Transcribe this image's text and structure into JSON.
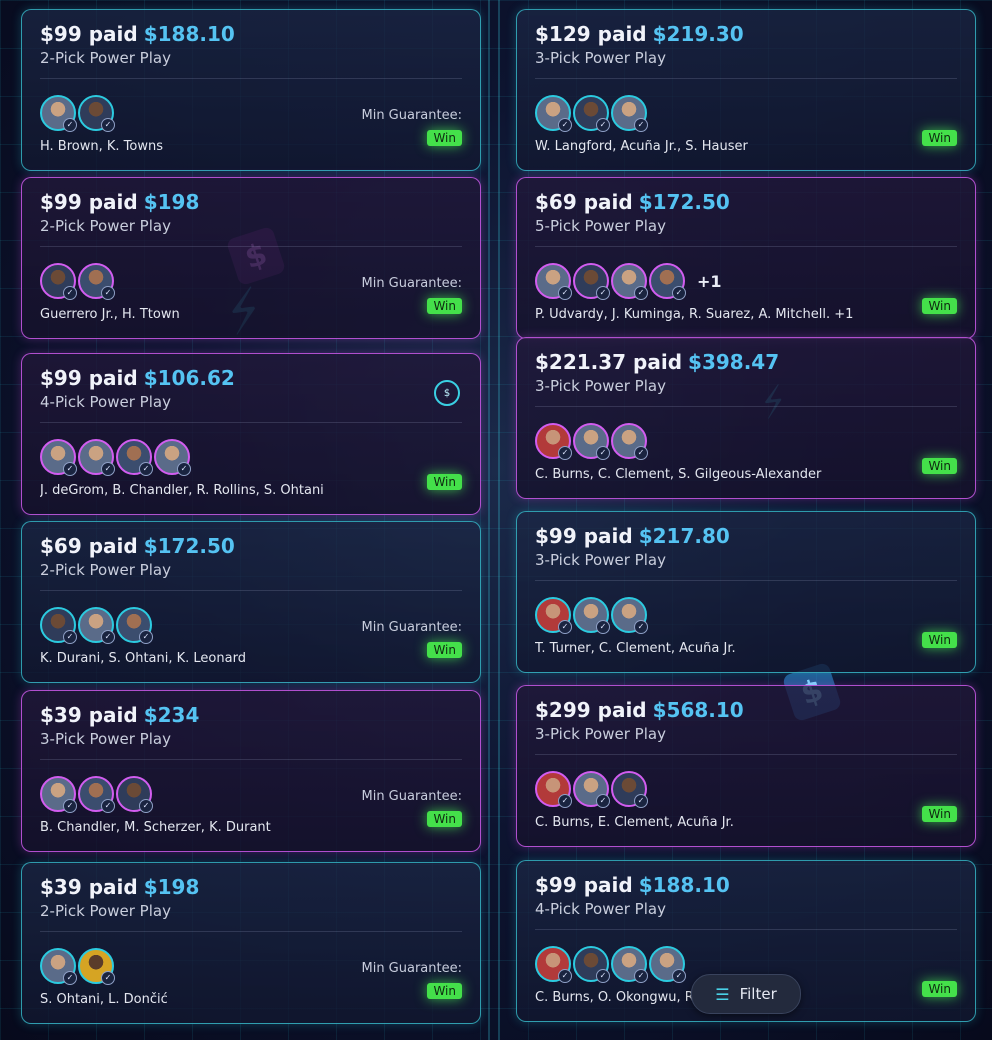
{
  "colors": {
    "accent_teal": "#3ac8d7",
    "accent_purple": "#cd5aeb",
    "payout_blue": "#55c3f2",
    "win_green": "#44e04a"
  },
  "filter_label": "Filter",
  "filter_icon": "sliders-icon",
  "cards": [
    {
      "paid": "$99 paid",
      "payout": "$188.10",
      "type": "2-Pick Power Play",
      "players": "H. Brown, K. Towns",
      "guarantee": "Min Guarantee:",
      "result": "Win",
      "avatars": 2,
      "more": "",
      "theme": "teal",
      "icon": ""
    },
    {
      "paid": "$99 paid",
      "payout": "$198",
      "type": "2-Pick Power Play",
      "players": "Guerrero Jr., H. Ttown",
      "guarantee": "Min Guarantee:",
      "result": "Win",
      "avatars": 2,
      "more": "",
      "theme": "purple",
      "icon": ""
    },
    {
      "paid": "$99 paid",
      "payout": "$106.62",
      "type": "4-Pick Power Play",
      "players": "J. deGrom, B. Chandler, R. Rollins, S. Ohtani",
      "guarantee": "",
      "result": "Win",
      "avatars": 4,
      "more": "",
      "theme": "purple",
      "icon": "money-bag-icon"
    },
    {
      "paid": "$69 paid",
      "payout": "$172.50",
      "type": "2-Pick Power Play",
      "players": "K. Durani, S. Ohtani, K. Leonard",
      "guarantee": "Min Guarantee:",
      "result": "Win",
      "avatars": 3,
      "more": "",
      "theme": "teal",
      "icon": ""
    },
    {
      "paid": "$39 paid",
      "payout": "$234",
      "type": "3-Pick Power Play",
      "players": "B. Chandler, M. Scherzer, K. Durant",
      "guarantee": "Min Guarantee:",
      "result": "Win",
      "avatars": 3,
      "more": "",
      "theme": "purple",
      "icon": ""
    },
    {
      "paid": "$39 paid",
      "payout": "$198",
      "type": "2-Pick Power Play",
      "players": "S. Ohtani, L. Dončić",
      "guarantee": "Min Guarantee:",
      "result": "Win",
      "avatars": 2,
      "more": "",
      "theme": "teal",
      "icon": ""
    },
    {
      "paid": "$129 paid",
      "payout": "$219.30",
      "type": "3-Pick Power Play",
      "players": "W. Langford, Acuña Jr., S. Hauser",
      "guarantee": "",
      "result": "Win",
      "avatars": 3,
      "more": "",
      "theme": "teal",
      "icon": ""
    },
    {
      "paid": "$69 paid",
      "payout": "$172.50",
      "type": "5-Pick Power Play",
      "players": "P. Udvardy, J. Kuminga, R. Suarez, A. Mitchell. +1",
      "guarantee": "",
      "result": "Win",
      "avatars": 4,
      "more": "+1",
      "theme": "purple",
      "icon": ""
    },
    {
      "paid": "$221.37 paid",
      "payout": "$398.47",
      "type": "3-Pick Power Play",
      "players": "C. Burns, C. Clement, S. Gilgeous-Alexander",
      "guarantee": "",
      "result": "Win",
      "avatars": 3,
      "more": "",
      "theme": "purple",
      "icon": ""
    },
    {
      "paid": "$99 paid",
      "payout": "$217.80",
      "type": "3-Pick Power Play",
      "players": "T. Turner, C. Clement, Acuña Jr.",
      "guarantee": "",
      "result": "Win",
      "avatars": 3,
      "more": "",
      "theme": "teal",
      "icon": ""
    },
    {
      "paid": "$299 paid",
      "payout": "$568.10",
      "type": "3-Pick Power Play",
      "players": "C. Burns, E. Clement, Acuña Jr.",
      "guarantee": "",
      "result": "Win",
      "avatars": 3,
      "more": "",
      "theme": "purple",
      "icon": ""
    },
    {
      "paid": "$99 paid",
      "payout": "$188.10",
      "type": "4-Pick Power Play",
      "players": "C. Burns, O. Okongwu, R.",
      "guarantee": "",
      "result": "Win",
      "avatars": 4,
      "more": "",
      "theme": "teal",
      "icon": ""
    }
  ]
}
